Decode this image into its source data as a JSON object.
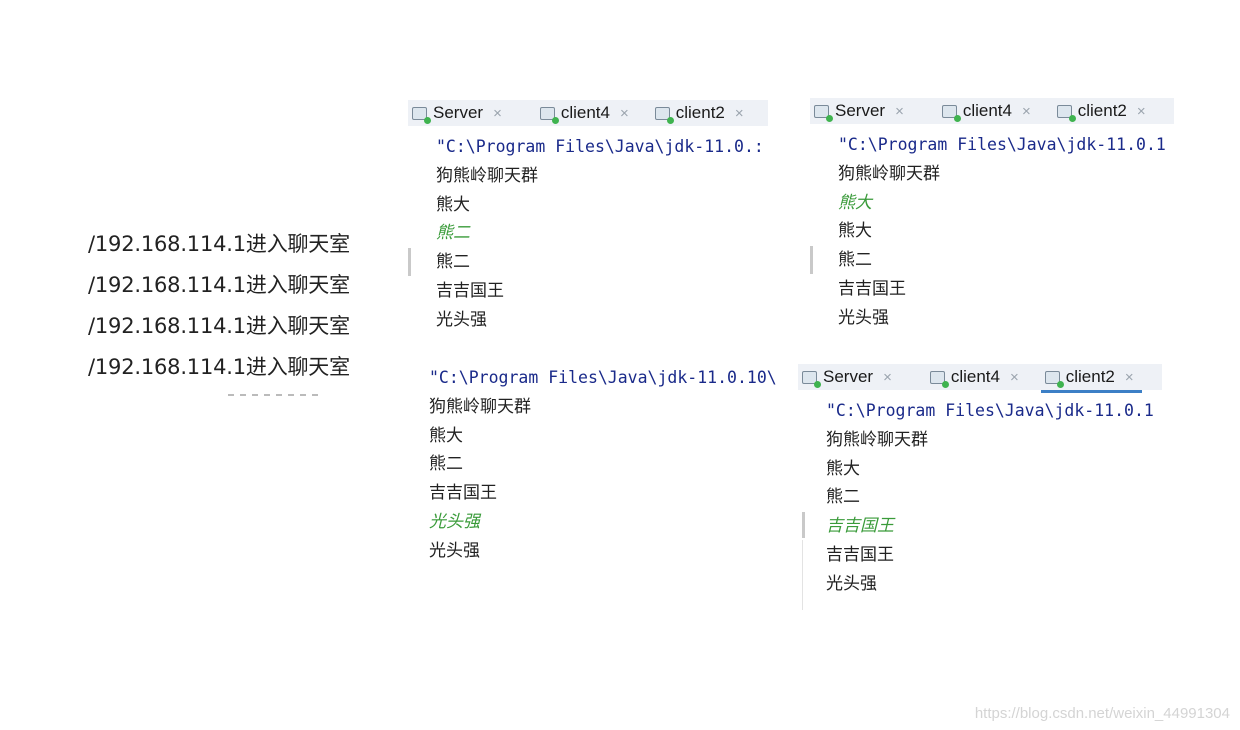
{
  "server_log": {
    "lines": [
      "/192.168.114.1进入聊天室",
      "/192.168.114.1进入聊天室",
      "/192.168.114.1进入聊天室",
      "/192.168.114.1进入聊天室"
    ]
  },
  "tabs": {
    "server": "Server",
    "client4": "client4",
    "client2": "client2",
    "close_glyph": "×"
  },
  "panel_a": {
    "cmd": "\"C:\\Program Files\\Java\\jdk-11.0.:",
    "lines": [
      "狗熊岭聊天群",
      "熊大",
      "熊二",
      "熊二",
      "吉吉国王",
      "光头强"
    ]
  },
  "panel_b": {
    "cmd": "\"C:\\Program Files\\Java\\jdk-11.0.1",
    "lines": [
      "狗熊岭聊天群",
      "熊大",
      "熊大",
      "熊二",
      "吉吉国王",
      "光头强"
    ]
  },
  "panel_c": {
    "cmd": "\"C:\\Program Files\\Java\\jdk-11.0.10\\",
    "lines": [
      "狗熊岭聊天群",
      "熊大",
      "熊二",
      "吉吉国王",
      "光头强",
      "光头强"
    ]
  },
  "panel_d": {
    "cmd": "\"C:\\Program Files\\Java\\jdk-11.0.1",
    "lines": [
      "狗熊岭聊天群",
      "熊大",
      "熊二",
      "吉吉国王",
      "吉吉国王",
      "光头强"
    ]
  },
  "colors": {
    "user_input": "#3a9b3a",
    "cmd_text": "#1a2a8a",
    "active_tab_underline": "#3c7fc6"
  },
  "watermark": "https://blog.csdn.net/weixin_44991304"
}
